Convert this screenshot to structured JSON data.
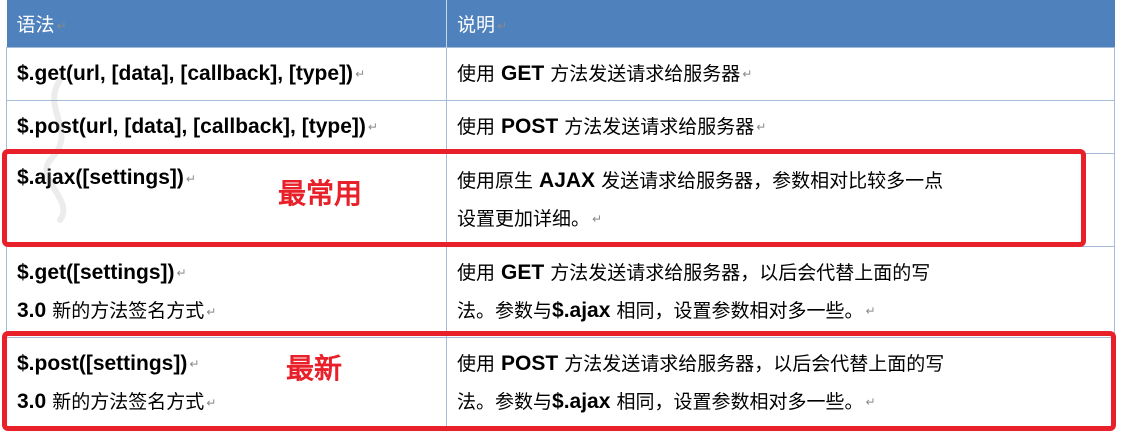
{
  "table": {
    "headers": {
      "syntax": "语法",
      "description": "说明"
    },
    "rows": [
      {
        "syntax": "$.get(url, [data], [callback], [type])",
        "description_parts": [
          "使用 ",
          "GET",
          " 方法发送请求给服务器"
        ]
      },
      {
        "syntax": "$.post(url, [data], [callback], [type])",
        "description_parts": [
          "使用 ",
          "POST",
          " 方法发送请求给服务器"
        ]
      },
      {
        "syntax": "$.ajax([settings])",
        "description_line1_parts": [
          "使用原生 ",
          "AJAX",
          " 发送请求给服务器，参数相对比较多一点"
        ],
        "description_line2": "设置更加详细。"
      },
      {
        "syntax": "$.get([settings])",
        "syntax_sub_parts": [
          "3.0",
          " 新的方法签名方式"
        ],
        "description_line1_parts": [
          "使用 ",
          "GET",
          " 方法发送请求给服务器，以后会代替上面的写"
        ],
        "description_line2_parts": [
          "法。参数与",
          "$.ajax",
          " 相同，设置参数相对多一些。"
        ]
      },
      {
        "syntax": "$.post([settings])",
        "syntax_sub_parts": [
          "3.0",
          " 新的方法签名方式"
        ],
        "description_line1_parts": [
          "使用 ",
          "POST",
          " 方法发送请求给服务器，以后会代替上面的写"
        ],
        "description_line2_parts": [
          "法。参数与",
          "$.ajax",
          " 相同，设置参数相对多一些。"
        ]
      }
    ]
  },
  "annotations": {
    "most_common": "最常用",
    "newest": "最新"
  },
  "paragraph_mark": "↵",
  "colors": {
    "header_bg": "#4f81bd",
    "header_text": "#ffffff",
    "highlight": "#e8202a",
    "grid": "#a6bbd8"
  }
}
